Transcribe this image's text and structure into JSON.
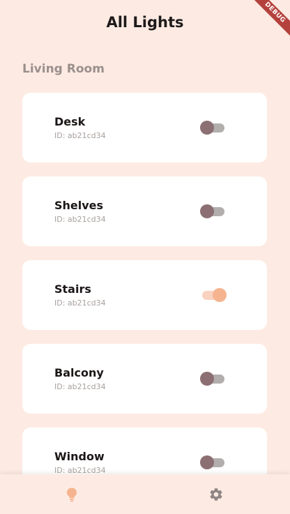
{
  "app": {
    "title": "All Lights",
    "debug_banner": "DEBUG"
  },
  "section": {
    "title": "Living Room"
  },
  "lights": [
    {
      "name": "Desk",
      "id": "ID: ab21cd34",
      "on": false
    },
    {
      "name": "Shelves",
      "id": "ID: ab21cd34",
      "on": false
    },
    {
      "name": "Stairs",
      "id": "ID: ab21cd34",
      "on": true
    },
    {
      "name": "Balcony",
      "id": "ID: ab21cd34",
      "on": false
    },
    {
      "name": "Window",
      "id": "ID: ab21cd34",
      "on": false
    }
  ],
  "bottom_nav": {
    "items": [
      {
        "icon": "lightbulb-icon",
        "active": true
      },
      {
        "icon": "gear-icon",
        "active": false
      }
    ]
  },
  "colors": {
    "background": "#fdebe3",
    "card": "#ffffff",
    "accent": "#f5b48f",
    "switch_off_thumb": "#8c6f72",
    "nav_inactive": "#8f8584",
    "debug_ribbon": "#b5413c"
  }
}
